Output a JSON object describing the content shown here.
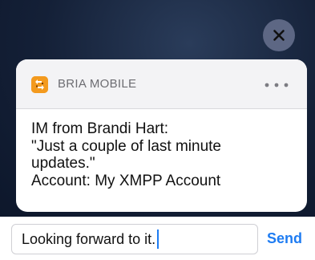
{
  "notification": {
    "app_name": "BRIA MOBILE",
    "app_icon": "bria-logo-icon",
    "more_icon": "ellipsis-icon",
    "close_icon": "close-icon",
    "message_lines": [
      "IM from Brandi Hart:",
      "\"Just a couple of last minute",
      "updates.\"",
      "Account: My XMPP Account"
    ]
  },
  "reply": {
    "value": "Looking forward to it.",
    "send_label": "Send"
  },
  "colors": {
    "accent": "#1e7cf2",
    "app_icon_bg": "#f39a1e"
  }
}
